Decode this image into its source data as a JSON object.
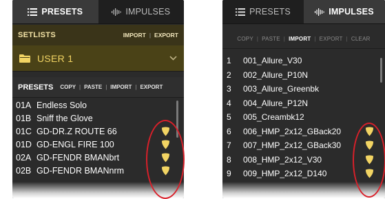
{
  "left_panel": {
    "tabs": [
      {
        "label": "PRESETS",
        "icon": "list-icon",
        "active": true
      },
      {
        "label": "IMPULSES",
        "icon": "waveform-icon",
        "active": false
      }
    ],
    "setlists": {
      "title": "SETLISTS",
      "actions": [
        "IMPORT",
        "EXPORT"
      ],
      "selected": "USER 1",
      "icon": "folder-icon"
    },
    "presets": {
      "title": "PRESETS",
      "actions": [
        "COPY",
        "PASTE",
        "IMPORT",
        "EXPORT"
      ],
      "items": [
        {
          "id": "01A",
          "name": "Endless Solo",
          "icon": false
        },
        {
          "id": "01B",
          "name": "Sniff the Glove",
          "icon": false
        },
        {
          "id": "01C",
          "name": "GD-DR.Z ROUTE 66",
          "icon": true
        },
        {
          "id": "01D",
          "name": "GD-ENGL FIRE 100",
          "icon": true
        },
        {
          "id": "02A",
          "name": "GD-FENDR BMANbrt",
          "icon": true
        },
        {
          "id": "02B",
          "name": "GD-FENDR BMANnrm",
          "icon": true
        }
      ]
    }
  },
  "right_panel": {
    "tabs": [
      {
        "label": "PRESETS",
        "icon": "list-icon",
        "active": false
      },
      {
        "label": "IMPULSES",
        "icon": "waveform-icon",
        "active": true
      }
    ],
    "toolbar": [
      {
        "label": "COPY",
        "enabled": false
      },
      {
        "label": "PASTE",
        "enabled": false
      },
      {
        "label": "IMPORT",
        "enabled": true
      },
      {
        "label": "EXPORT",
        "enabled": false
      },
      {
        "label": "CLEAR",
        "enabled": false
      }
    ],
    "impulses": [
      {
        "num": "1",
        "name": "001_Allure_V30",
        "icon": false
      },
      {
        "num": "2",
        "name": "002_Allure_P10N",
        "icon": false
      },
      {
        "num": "3",
        "name": "003_Allure_Greenbk",
        "icon": false
      },
      {
        "num": "4",
        "name": "004_Allure_P12N",
        "icon": false
      },
      {
        "num": "5",
        "name": "005_Creambk12",
        "icon": false
      },
      {
        "num": "6",
        "name": "006_HMP_2x12_GBack20",
        "icon": true
      },
      {
        "num": "7",
        "name": "007_HMP_2x12_GBack30",
        "icon": true
      },
      {
        "num": "8",
        "name": "008_HMP_2x12_V30",
        "icon": true
      },
      {
        "num": "9",
        "name": "009_HMP_2x12_D140",
        "icon": true
      }
    ]
  },
  "colors": {
    "accent": "#f2d463",
    "highlight": "#d9202a",
    "panel_bg": "#2b2b2b"
  }
}
